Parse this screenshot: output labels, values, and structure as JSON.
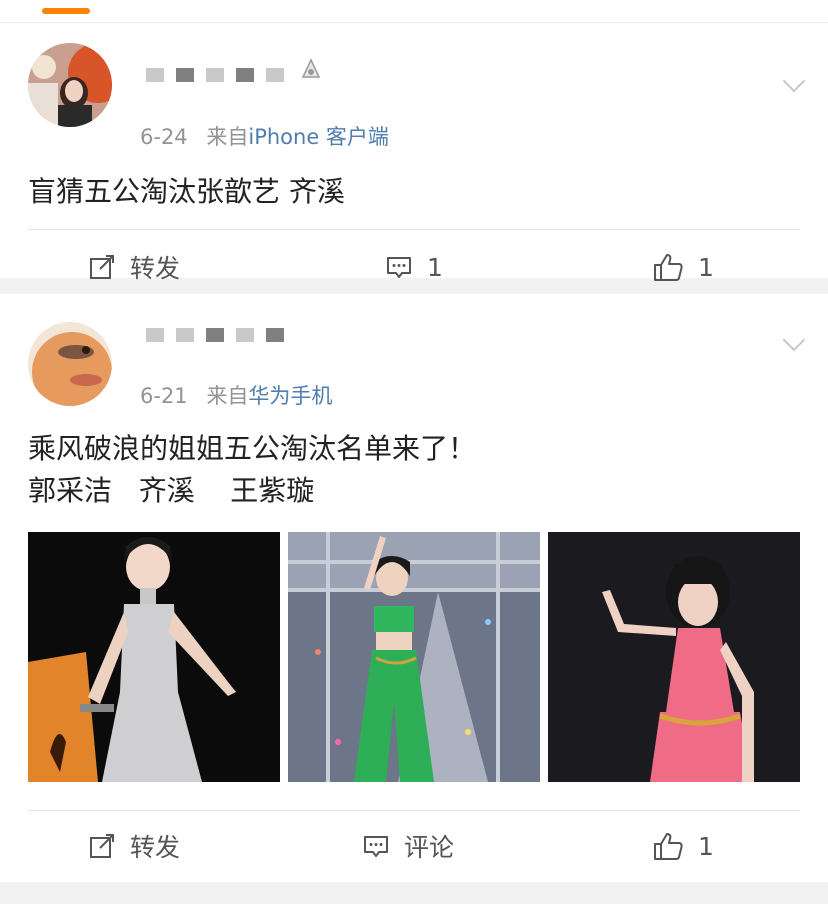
{
  "posts": [
    {
      "username": "𝓫𝓵𝓾𝓻𝓻𝓮𝓭",
      "date": "6-24",
      "source_prefix": "来自",
      "source": "iPhone 客户端",
      "text_lines": [
        "盲猜五公淘汰张歆艺 齐溪"
      ],
      "actions": {
        "repost": "转发",
        "comment": "1",
        "like": "1"
      }
    },
    {
      "username": "𝓫𝓵𝓾𝓻𝓻𝓮𝓭",
      "date": "6-21",
      "source_prefix": "来自",
      "source": "华为手机",
      "text_lines": [
        "乘风破浪的姐姐五公淘汰名单来了！",
        "郭采洁   齐溪    王紫璇"
      ],
      "actions": {
        "repost": "转发",
        "comment": "评论",
        "like": "1"
      }
    }
  ],
  "colors": {
    "accent": "#ff8200",
    "link": "#507daf",
    "meta": "#939393"
  },
  "icons": [
    "repost-icon",
    "comment-icon",
    "like-icon",
    "chevron-down-icon"
  ]
}
